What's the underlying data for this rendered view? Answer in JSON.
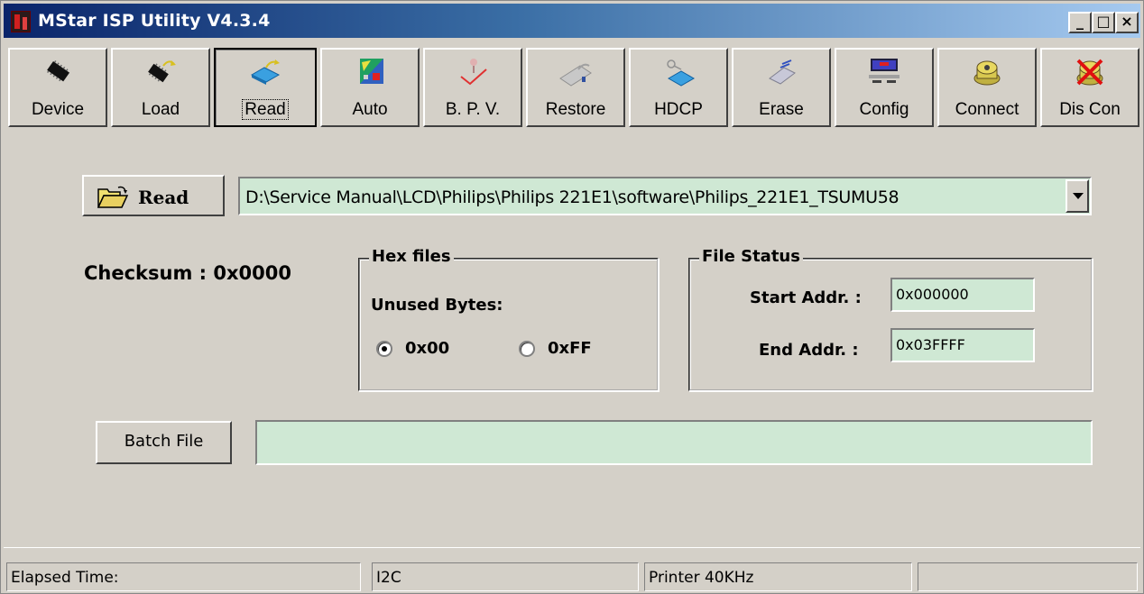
{
  "window": {
    "title": "MStar ISP Utility V4.3.4",
    "minimize": "_",
    "maximize": "□",
    "close": "×"
  },
  "toolbar": {
    "items": [
      {
        "label": "Device",
        "icon": "chip-icon"
      },
      {
        "label": "Load",
        "icon": "load-chip-icon"
      },
      {
        "label": "Read",
        "icon": "read-icon",
        "pressed": true
      },
      {
        "label": "Auto",
        "icon": "auto-icon"
      },
      {
        "label": "B. P. V.",
        "icon": "bpv-icon"
      },
      {
        "label": "Restore",
        "icon": "restore-icon"
      },
      {
        "label": "HDCP",
        "icon": "hdcp-icon"
      },
      {
        "label": "Erase",
        "icon": "erase-icon"
      },
      {
        "label": "Config",
        "icon": "config-icon"
      },
      {
        "label": "Connect",
        "icon": "connect-icon"
      },
      {
        "label": "Dis Con",
        "icon": "disconnect-icon"
      }
    ]
  },
  "read": {
    "button_label": "Read",
    "path": "D:\\Service Manual\\LCD\\Philips\\Philips 221E1\\software\\Philips_221E1_TSUMU58"
  },
  "checksum": "Checksum : 0x0000",
  "hex_files": {
    "title": "Hex files",
    "unused_bytes_label": "Unused Bytes:",
    "options": [
      "0x00",
      "0xFF"
    ],
    "selected": "0x00"
  },
  "file_status": {
    "title": "File Status",
    "start_label": "Start Addr. :",
    "start_value": "0x000000",
    "end_label": "End Addr. :",
    "end_value": "0x03FFFF"
  },
  "batch": {
    "button_label": "Batch File",
    "value": ""
  },
  "statusbar": {
    "elapsed": "Elapsed Time:",
    "bus": "I2C",
    "port": "Printer  40KHz",
    "extra": ""
  },
  "colors": {
    "field_bg": "#cfe8d4",
    "face": "#d4d0c8",
    "title_start": "#0a246a",
    "title_end": "#a6caf0"
  }
}
